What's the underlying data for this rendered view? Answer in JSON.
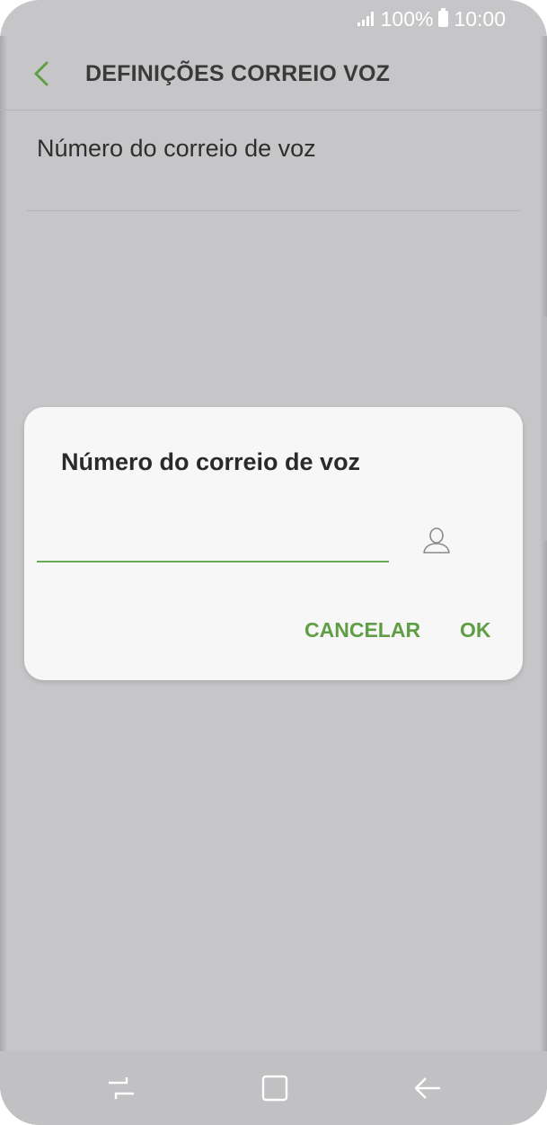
{
  "status_bar": {
    "battery": "100%",
    "time": "10:00"
  },
  "app_bar": {
    "title": "DEFINIÇÕES CORREIO VOZ",
    "back_icon": "chevron-left-icon"
  },
  "preference": {
    "title": "Número do correio de voz"
  },
  "dialog": {
    "title": "Número do correio de voz",
    "input_value": "",
    "input_placeholder": "",
    "contact_icon": "contact-person-icon",
    "cancel_label": "CANCELAR",
    "ok_label": "OK"
  },
  "navigation_bar": {
    "items": [
      "recent-apps-icon",
      "home-icon",
      "back-arrow-icon"
    ]
  },
  "colors": {
    "accent": "#5f9e45",
    "background": "#c6c6c8",
    "dialog_background": "#f7f7f7"
  }
}
